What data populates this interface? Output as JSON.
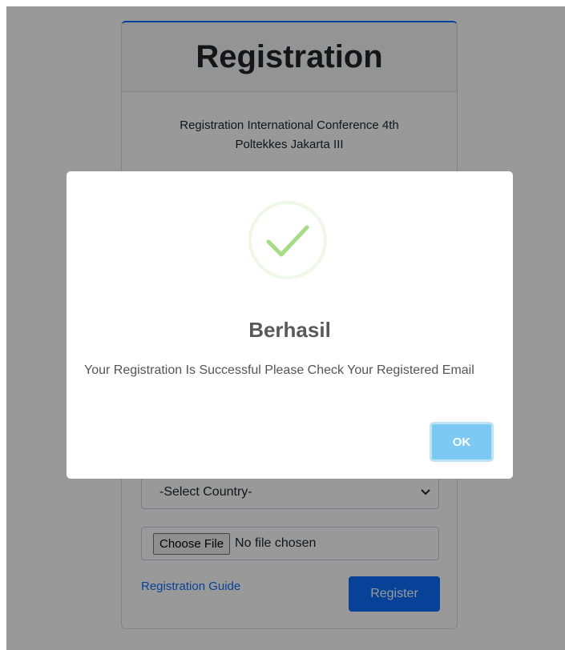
{
  "card": {
    "title": "Registration",
    "subtitle_line1": "Registration International Conference 4th",
    "subtitle_line2": "Poltekkes Jakarta III"
  },
  "form": {
    "country_select": "-Select Country-",
    "file_button": "Choose File",
    "file_status": "No file chosen",
    "guide_link": "Registration Guide",
    "register_button": "Register"
  },
  "modal": {
    "title": "Berhasil",
    "message": "Your Registration Is Successful Please Check Your Registered Email",
    "ok_button": "OK",
    "icon": "check-icon",
    "success_color": "#a5dc86"
  },
  "colors": {
    "primary": "#0d6efd",
    "ok_button": "#7cc9f4"
  }
}
